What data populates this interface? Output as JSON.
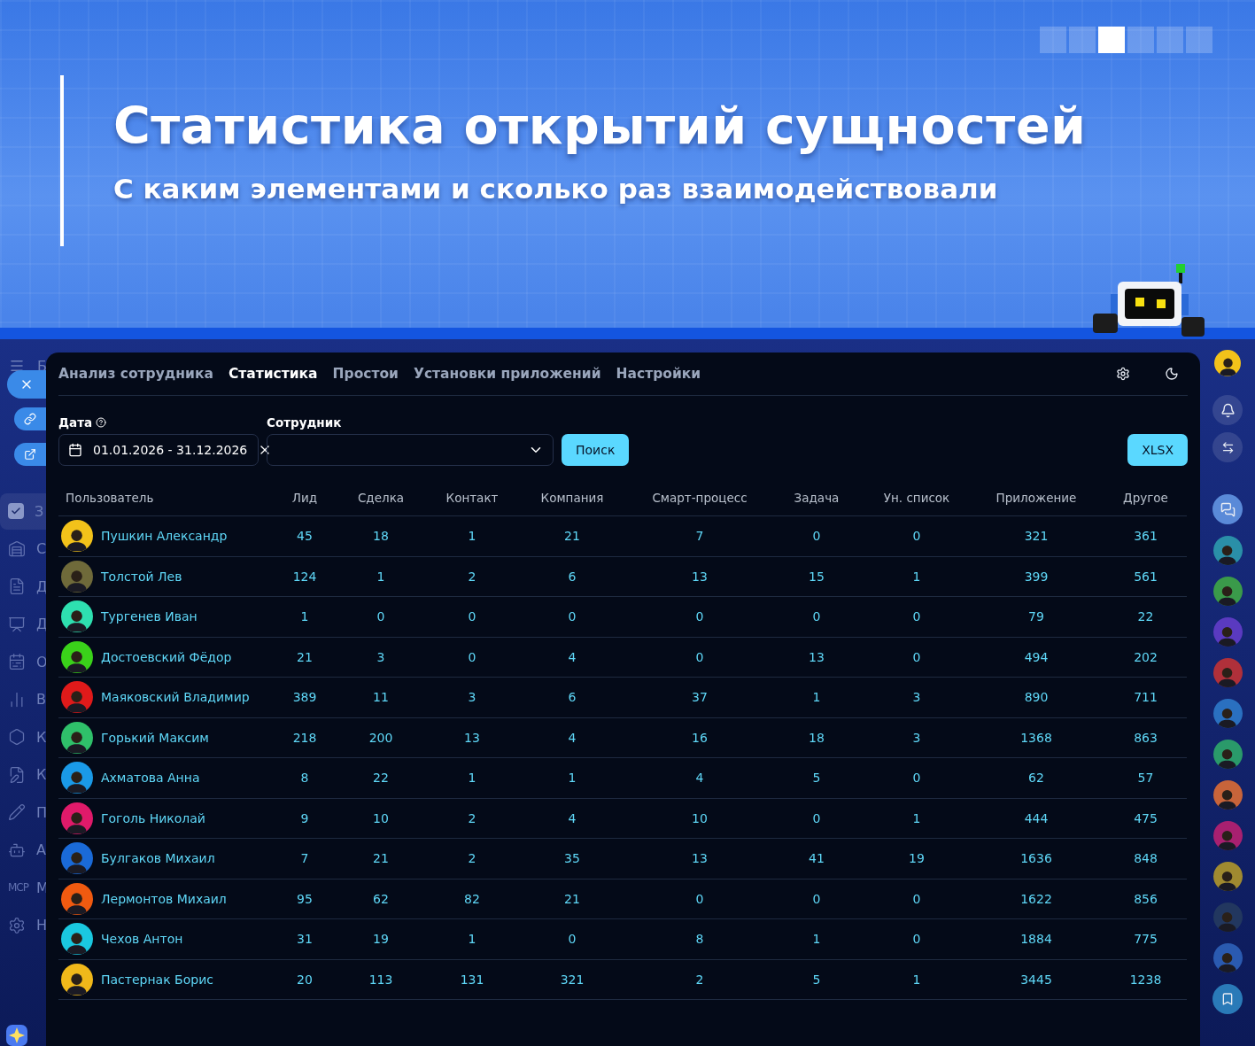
{
  "banner": {
    "title": "Статистика открытий сущностей",
    "subtitle": "С каким элементами и сколько раз взаимодействовали",
    "slides": [
      {
        "selected": false
      },
      {
        "selected": false
      },
      {
        "selected": true
      },
      {
        "selected": false
      },
      {
        "selected": false
      },
      {
        "selected": false
      }
    ]
  },
  "left_sidebar": {
    "header": "Б",
    "items": [
      {
        "label": "З",
        "selected": true
      },
      {
        "label": "С",
        "selected": false
      },
      {
        "label": "Д",
        "selected": false
      },
      {
        "label": "Д",
        "selected": false
      },
      {
        "label": "О",
        "selected": false
      },
      {
        "label": "В",
        "selected": false
      },
      {
        "label": "К",
        "selected": false
      },
      {
        "label": "К",
        "selected": false
      },
      {
        "label": "П",
        "selected": false
      },
      {
        "label": "А",
        "selected": false
      },
      {
        "label": "М",
        "selected": false,
        "icon_text": "MCP"
      },
      {
        "label": "Н",
        "selected": false
      }
    ]
  },
  "panel": {
    "tabs": [
      {
        "label": "Анализ сотрудника",
        "selected": false
      },
      {
        "label": "Статистика",
        "selected": true
      },
      {
        "label": "Простои",
        "selected": false
      },
      {
        "label": "Установки приложений",
        "selected": false
      },
      {
        "label": "Настройки",
        "selected": false
      }
    ],
    "date_filter": {
      "label": "Дата",
      "value": "01.01.2026 - 31.12.2026"
    },
    "employee_filter": {
      "label": "Сотрудник"
    },
    "search_button": "Поиск",
    "export_button": "XLSX",
    "table": {
      "columns": [
        "Пользователь",
        "Лид",
        "Сделка",
        "Контакт",
        "Компания",
        "Смарт-процесс",
        "Задача",
        "Ун. список",
        "Приложение",
        "Другое"
      ],
      "rows": [
        {
          "name": "Пушкин Александр",
          "color": "#f2c21a",
          "values": [
            "45",
            "18",
            "1",
            "21",
            "7",
            "0",
            "0",
            "321",
            "361"
          ]
        },
        {
          "name": "Толстой Лев",
          "color": "#6f6a3a",
          "values": [
            "124",
            "1",
            "2",
            "6",
            "13",
            "15",
            "1",
            "399",
            "561"
          ]
        },
        {
          "name": "Тургенев Иван",
          "color": "#2ee0b0",
          "values": [
            "1",
            "0",
            "0",
            "0",
            "0",
            "0",
            "0",
            "79",
            "22"
          ]
        },
        {
          "name": "Достоевский Фёдор",
          "color": "#3ad21a",
          "values": [
            "21",
            "3",
            "0",
            "4",
            "0",
            "13",
            "0",
            "494",
            "202"
          ]
        },
        {
          "name": "Маяковский Владимир",
          "color": "#e01a1a",
          "values": [
            "389",
            "11",
            "3",
            "6",
            "37",
            "1",
            "3",
            "890",
            "711"
          ]
        },
        {
          "name": "Горький Максим",
          "color": "#2fc06a",
          "values": [
            "218",
            "200",
            "13",
            "4",
            "16",
            "18",
            "3",
            "1368",
            "863"
          ]
        },
        {
          "name": "Ахматова Анна",
          "color": "#1a9ae8",
          "values": [
            "8",
            "22",
            "1",
            "1",
            "4",
            "5",
            "0",
            "62",
            "57"
          ]
        },
        {
          "name": "Гоголь Николай",
          "color": "#e01a6a",
          "values": [
            "9",
            "10",
            "2",
            "4",
            "10",
            "0",
            "1",
            "444",
            "475"
          ]
        },
        {
          "name": "Булгаков Михаил",
          "color": "#1a6ad8",
          "values": [
            "7",
            "21",
            "2",
            "35",
            "13",
            "41",
            "19",
            "1636",
            "848"
          ]
        },
        {
          "name": "Лермонтов Михаил",
          "color": "#f05a10",
          "values": [
            "95",
            "62",
            "82",
            "21",
            "0",
            "0",
            "0",
            "1622",
            "856"
          ]
        },
        {
          "name": "Чехов Антон",
          "color": "#1ac8e0",
          "values": [
            "31",
            "19",
            "1",
            "0",
            "8",
            "1",
            "0",
            "1884",
            "775"
          ]
        },
        {
          "name": "Пастернак Борис",
          "color": "#f0b81a",
          "values": [
            "20",
            "113",
            "131",
            "321",
            "2",
            "5",
            "1",
            "3445",
            "1238"
          ]
        }
      ]
    }
  },
  "right_sidebar": {
    "profile": {
      "color": "#f2c21a"
    },
    "contacts": [
      {
        "color": "#2a8fa8"
      },
      {
        "color": "#3a9a4a"
      },
      {
        "color": "#5a3ac0"
      },
      {
        "color": "#b0303a"
      },
      {
        "color": "#2a70c0"
      },
      {
        "color": "#2a9a6a"
      },
      {
        "color": "#c8643a"
      },
      {
        "color": "#a82070"
      },
      {
        "color": "#a08a30"
      },
      {
        "color": "#22375f"
      },
      {
        "color": "#2a5ab0"
      }
    ]
  }
}
